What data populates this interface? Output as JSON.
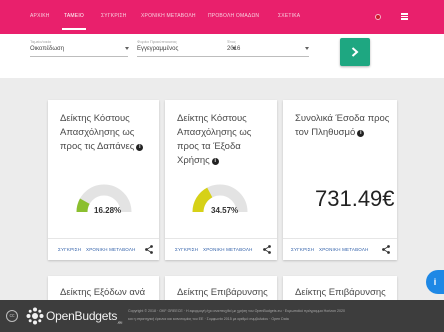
{
  "nav": {
    "tabs": [
      {
        "label": "ΑΡΧΙΚΗ"
      },
      {
        "label": "ΤΑΜΕΙΟ"
      },
      {
        "label": "ΣΥΓΚΡΙΣΗ"
      },
      {
        "label": "ΧΡΟΝΙΚΗ ΜΕΤΑΒΟΛΗ"
      },
      {
        "label": "ΠΡΟΒΟΛΗ ΟΜΑΔΩΝ"
      },
      {
        "label": "ΣΧΕΤΙΚΑ"
      }
    ],
    "active_tab": "ΤΑΜΕΙΟ",
    "accent": "#e9206c"
  },
  "filters": {
    "fund": {
      "label": "Ταμείο/οικία",
      "value": "Οικοπέδωση"
    },
    "reference": {
      "label": "Φορέα Προκύπτουσας",
      "value": "Εγγεγραμμένος"
    },
    "year": {
      "label": "Έτος",
      "value": "2016"
    }
  },
  "go_button": {
    "icon": "chevron-right-icon",
    "color": "#1ea781"
  },
  "cards": [
    {
      "title": "Δείκτης Κόστους Απασχόλησης ως προς τις Δαπάνες",
      "value": "16.28%",
      "gauge_fraction": 0.1628,
      "gauge_color": "#8bbf2f",
      "action_compare": "ΣΥΓΚΡΙΣΗ",
      "action_timeline": "ΧΡΟΝΙΚΗ ΜΕΤΑΒΟΛΗ"
    },
    {
      "title": "Δείκτης Κόστους Απασχόλησης ως προς τα Έξοδα Χρήσης",
      "value": "34.57%",
      "gauge_fraction": 0.3457,
      "gauge_color": "#d6d117",
      "action_compare": "ΣΥΓΚΡΙΣΗ",
      "action_timeline": "ΧΡΟΝΙΚΗ ΜΕΤΑΒΟΛΗ"
    },
    {
      "title": "Συνολικά Έσοδα προς τον Πληθυσμό",
      "value": "731.49€",
      "action_compare": "ΣΥΓΚΡΙΣΗ",
      "action_timeline": "ΧΡΟΝΙΚΗ ΜΕΤΑΒΟΛΗ"
    }
  ],
  "cards_row2": [
    {
      "title": "Δείκτης Εξόδων ανά"
    },
    {
      "title": "Δείκτης Επιβάρυνσης"
    },
    {
      "title": "Δείκτης Επιβάρυνσης"
    }
  ],
  "info_glyph": "i",
  "fab_label": "i",
  "footer": {
    "cc_label": "cc",
    "brand": "OpenBudgets",
    "brand_suffix": ".eu",
    "line1": "Copyright © 2018 · OKF GREECE · Η εφαρμογή έχει αναπτυχθεί με χρήση του OpenBudgets.eu · Ευρωπαϊκό πρόγραμμα Horizon 2020",
    "line2": "και η στρατηγική έρευνα και καινοτομίας του ΕΕ · Συμφωνία 2015 με αριθμό συμβολαίου · Open Data"
  }
}
